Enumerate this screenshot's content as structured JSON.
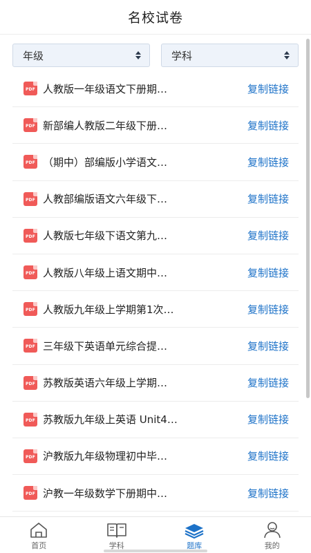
{
  "header": {
    "title": "名校试卷"
  },
  "filters": {
    "grade_label": "年级",
    "subject_label": "学科"
  },
  "list": {
    "copy_label": "复制链接",
    "file_badge": "PDF",
    "items": [
      {
        "name": "人教版一年级语文下册期…"
      },
      {
        "name": "新部编人教版二年级下册…"
      },
      {
        "name": "（期中）部编版小学语文…"
      },
      {
        "name": "人教部编版语文六年级下…"
      },
      {
        "name": "人教版七年级下语文第九…"
      },
      {
        "name": "人教版八年级上语文期中…"
      },
      {
        "name": "人教版九年级上学期第1次…"
      },
      {
        "name": "三年级下英语单元综合提…"
      },
      {
        "name": "苏教版英语六年级上学期…"
      },
      {
        "name": "苏教版九年级上英语 Unit4…"
      },
      {
        "name": "沪教版九年级物理初中毕…"
      },
      {
        "name": "沪教一年级数学下册期中…"
      }
    ]
  },
  "tabbar": {
    "tabs": [
      {
        "label": "首页",
        "icon": "home-icon",
        "active": false
      },
      {
        "label": "学科",
        "icon": "book-icon",
        "active": false
      },
      {
        "label": "题库",
        "icon": "layers-icon",
        "active": true
      },
      {
        "label": "我的",
        "icon": "user-icon",
        "active": false
      }
    ]
  },
  "colors": {
    "accent": "#1d72c8",
    "pdf_red": "#f05a58",
    "select_bg": "#eef3fa"
  }
}
